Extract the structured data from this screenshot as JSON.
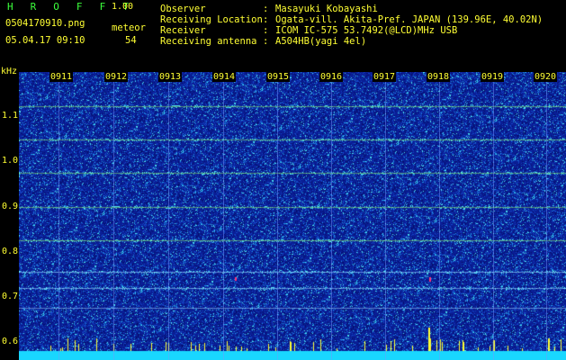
{
  "app": {
    "title": "H R O F F T",
    "version": "1.00",
    "file_name": "0504170910.png",
    "mode": "meteor",
    "date_time": "05.04.17 09:10",
    "count": "54"
  },
  "station": {
    "observer_label": "Observer",
    "observer": "Masayuki Kobayashi",
    "location_label": "Receiving Location",
    "location": "Ogata-vill. Akita-Pref. JAPAN (139.96E, 40.02N)",
    "receiver_label": "Receiver",
    "receiver": "ICOM IC-575 53.7492(@LCD)MHz USB",
    "antenna_label": "Receiving antenna",
    "antenna": "A504HB(yagi 4el)",
    "separator": ":"
  },
  "axis": {
    "unit": "kHz",
    "ytick_labels": [
      "1.1",
      "1.0",
      "0.9",
      "0.8",
      "0.7",
      "0.6"
    ],
    "time_labels": [
      "0911",
      "0912",
      "0913",
      "0914",
      "0915",
      "0916",
      "0917",
      "0918",
      "0919",
      "0920"
    ]
  },
  "colors": {
    "header_text": "#3cff3c",
    "axis_text": "#ffff33",
    "background": "#000000",
    "spectrum_base": "#0a1f9a"
  }
}
